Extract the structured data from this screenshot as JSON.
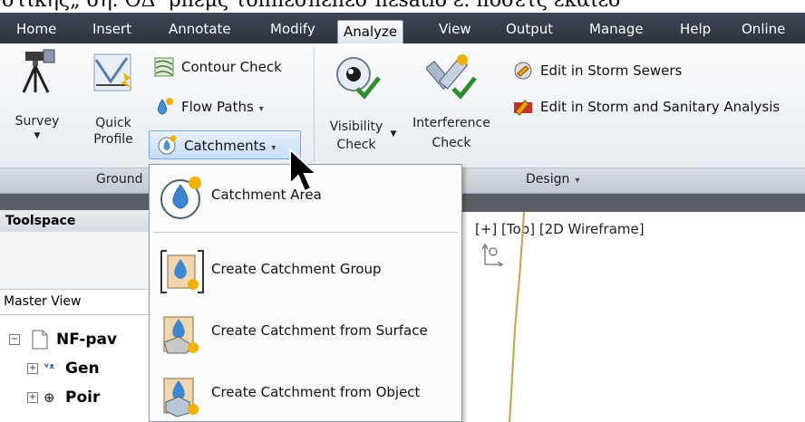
{
  "caption": {
    "text": "στικής„ ση. ΟΔ″ ρπεμς τοππεσπεπεσ πεsatio ε. ποσετς εκαιεσ"
  },
  "menu": {
    "tabs": [
      {
        "label": "Home"
      },
      {
        "label": "Insert"
      },
      {
        "label": "Annotate"
      },
      {
        "label": "Modify"
      },
      {
        "label": "Analyze"
      },
      {
        "label": "View"
      },
      {
        "label": "Output"
      },
      {
        "label": "Manage"
      },
      {
        "label": "Help"
      },
      {
        "label": "Online"
      }
    ],
    "active_tab": "Analyze"
  },
  "ribbon": {
    "survey": {
      "label": "Survey"
    },
    "quick_profile": {
      "line1": "Quick",
      "line2": "Profile"
    },
    "contour_check": {
      "label": "Contour Check"
    },
    "flow_paths": {
      "label": "Flow Paths"
    },
    "catchments": {
      "label": "Catchments"
    },
    "visibility_check": {
      "line1": "Visibility",
      "line2": "Check"
    },
    "interference_check": {
      "line1": "Interference",
      "line2": "Check"
    },
    "edit_storm_sewers": {
      "label": "Edit in Storm Sewers"
    },
    "edit_storm_sanitary": {
      "label": "Edit in Storm and Sanitary Analysis"
    }
  },
  "panels": {
    "ground": {
      "label": "Ground"
    },
    "design": {
      "label": "Design"
    }
  },
  "dropdown": {
    "items": [
      {
        "label": "Catchment Area"
      },
      {
        "label": "Create Catchment Group"
      },
      {
        "label": "Create Catchment from Surface"
      },
      {
        "label": "Create Catchment from Object"
      }
    ]
  },
  "toolspace": {
    "title": "Toolspace",
    "view": "Master View",
    "tree": [
      {
        "label": "NF-pav"
      },
      {
        "label": "Gen"
      },
      {
        "label": "Poir"
      }
    ]
  },
  "viewport": {
    "label": "[+] [Top] [2D Wireframe]"
  },
  "colors": {
    "menubar": "#2d333e",
    "highlight": "#c5ddf7",
    "check_green": "#2e8b2e"
  }
}
